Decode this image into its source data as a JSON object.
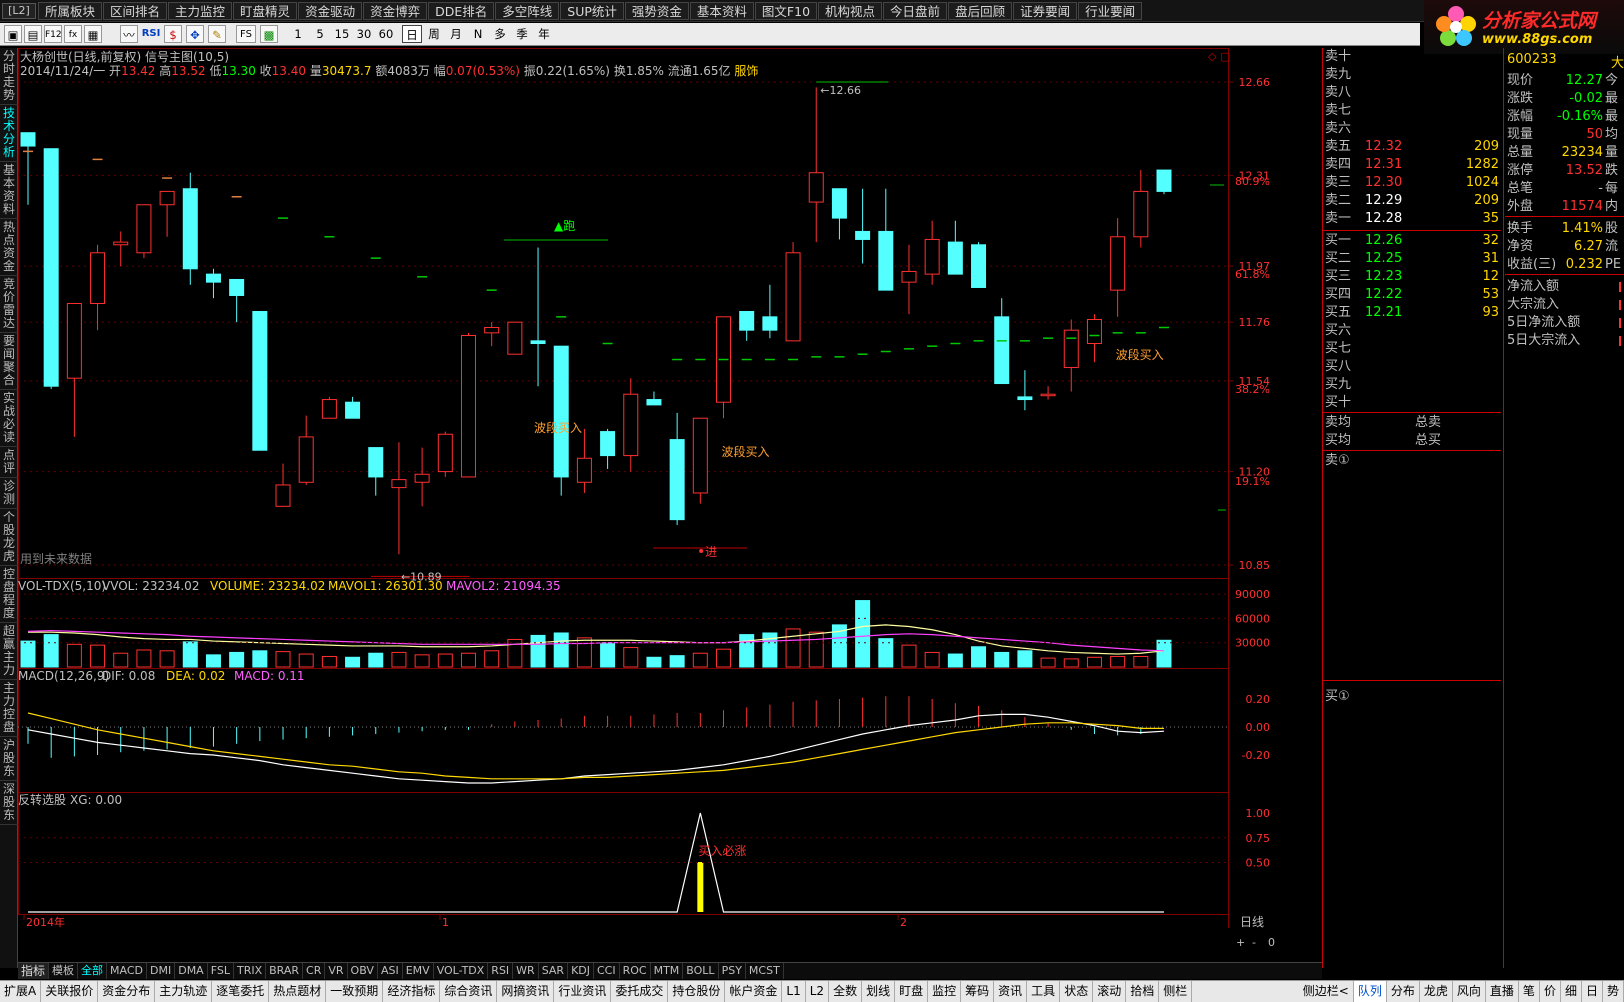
{
  "menu": {
    "tag": "[L2]",
    "items": [
      "所属板块",
      "区间排名",
      "主力监控",
      "盯盘精灵",
      "资金驱动",
      "资金博弈",
      "DDE排名",
      "多空阵线",
      "SUP统计",
      "强势资金",
      "基本资料",
      "图文F10",
      "机构视点",
      "今日盘前",
      "盘后回顾",
      "证券要闻",
      "行业要闻"
    ]
  },
  "logo": {
    "title": "分析家公式网",
    "url_text": "www.88gs.com"
  },
  "toolbar": {
    "rsi_label": "RSI",
    "fs_label": "FS",
    "minute_periods": [
      "1",
      "5",
      "15",
      "30",
      "60"
    ],
    "periods": [
      "日",
      "周",
      "月",
      "N",
      "多",
      "季",
      "年"
    ],
    "active_period": "日"
  },
  "left_tabs": [
    "分时走势",
    "技术分析",
    "基本资料",
    "热点资金",
    "竞价雷达",
    "要闻聚合",
    "实战必读",
    "点评",
    "诊测",
    "个股龙虎",
    "控盘程度",
    "超赢主力",
    "主力控盘",
    "沪股东",
    "深股东"
  ],
  "stock": {
    "title": "大杨创世(日线,前复权) 信号主图(10,5)",
    "date": "2014/11/24/一",
    "open_label": "开",
    "open": "13.42",
    "high_label": "高",
    "high": "13.52",
    "low_label": "低",
    "low": "13.30",
    "close_label": "收",
    "close": "13.40",
    "vol_label": "量",
    "vol": "30473.7",
    "amt_label": "额",
    "amt": "4083万",
    "chg_label": "幅",
    "chg": "0.07(0.53%)",
    "amp_label": "振",
    "amp": "0.22(1.65%)",
    "turnover_label": "换",
    "turnover": "1.85%",
    "float_label": "流通",
    "float": "1.65亿",
    "industry": "服饰"
  },
  "chart_data": [
    {
      "type": "candlestick",
      "title": "大杨创世(日线,前复权) 信号主图(10,5)",
      "y_ticks": [
        "12.66",
        "12.31",
        "11.97",
        "11.76",
        "11.54",
        "11.20",
        "10.85"
      ],
      "pct_ticks": [
        "80.9%",
        "61.8%",
        "38.2%",
        "19.1%"
      ],
      "x_labels": [
        "2014年",
        "1",
        "2"
      ],
      "candles": [
        {
          "o": 12.47,
          "h": 12.47,
          "l": 12.2,
          "c": 12.42
        },
        {
          "o": 12.41,
          "h": 12.41,
          "l": 11.51,
          "c": 11.52
        },
        {
          "o": 11.55,
          "h": 11.83,
          "l": 11.33,
          "c": 11.83
        },
        {
          "o": 11.83,
          "h": 12.05,
          "l": 11.73,
          "c": 12.02
        },
        {
          "o": 12.05,
          "h": 12.1,
          "l": 11.97,
          "c": 12.06
        },
        {
          "o": 12.02,
          "h": 12.2,
          "l": 12.0,
          "c": 12.2
        },
        {
          "o": 12.2,
          "h": 12.25,
          "l": 12.08,
          "c": 12.25
        },
        {
          "o": 12.26,
          "h": 12.32,
          "l": 11.9,
          "c": 11.96
        },
        {
          "o": 11.94,
          "h": 11.96,
          "l": 11.85,
          "c": 11.91
        },
        {
          "o": 11.92,
          "h": 11.92,
          "l": 11.76,
          "c": 11.86
        },
        {
          "o": 11.8,
          "h": 11.8,
          "l": 11.28,
          "c": 11.28
        },
        {
          "o": 11.07,
          "h": 11.23,
          "l": 11.07,
          "c": 11.15
        },
        {
          "o": 11.16,
          "h": 11.41,
          "l": 11.15,
          "c": 11.33
        },
        {
          "o": 11.4,
          "h": 11.48,
          "l": 11.4,
          "c": 11.47
        },
        {
          "o": 11.46,
          "h": 11.48,
          "l": 11.42,
          "c": 11.4
        },
        {
          "o": 11.29,
          "h": 11.29,
          "l": 11.11,
          "c": 11.18
        },
        {
          "o": 11.14,
          "h": 11.31,
          "l": 10.89,
          "c": 11.17
        },
        {
          "o": 11.16,
          "h": 11.29,
          "l": 11.07,
          "c": 11.19
        },
        {
          "o": 11.2,
          "h": 11.35,
          "l": 11.18,
          "c": 11.34
        },
        {
          "o": 11.18,
          "h": 11.72,
          "l": 11.18,
          "c": 11.71
        },
        {
          "o": 11.72,
          "h": 11.76,
          "l": 11.67,
          "c": 11.74
        },
        {
          "o": 11.64,
          "h": 11.71,
          "l": 11.7,
          "c": 11.76
        },
        {
          "o": 11.69,
          "h": 12.04,
          "l": 11.52,
          "c": 11.68
        },
        {
          "o": 11.67,
          "h": 11.67,
          "l": 11.11,
          "c": 11.18
        },
        {
          "o": 11.16,
          "h": 11.36,
          "l": 11.12,
          "c": 11.25
        },
        {
          "o": 11.35,
          "h": 11.36,
          "l": 11.21,
          "c": 11.26
        },
        {
          "o": 11.26,
          "h": 11.55,
          "l": 11.2,
          "c": 11.49
        },
        {
          "o": 11.47,
          "h": 11.5,
          "l": 11.47,
          "c": 11.45
        },
        {
          "o": 11.32,
          "h": 11.42,
          "l": 11.0,
          "c": 11.02
        },
        {
          "o": 11.12,
          "h": 11.4,
          "l": 11.08,
          "c": 11.4
        },
        {
          "o": 11.46,
          "h": 11.78,
          "l": 11.4,
          "c": 11.78
        },
        {
          "o": 11.8,
          "h": 11.8,
          "l": 11.69,
          "c": 11.73
        },
        {
          "o": 11.78,
          "h": 11.9,
          "l": 11.7,
          "c": 11.73
        },
        {
          "o": 11.69,
          "h": 12.06,
          "l": 11.69,
          "c": 12.02
        },
        {
          "o": 12.21,
          "h": 12.64,
          "l": 12.06,
          "c": 12.32
        },
        {
          "o": 12.26,
          "h": 12.25,
          "l": 12.07,
          "c": 12.15
        },
        {
          "o": 12.1,
          "h": 12.26,
          "l": 11.98,
          "c": 12.07
        },
        {
          "o": 12.1,
          "h": 12.26,
          "l": 11.88,
          "c": 11.88
        },
        {
          "o": 11.91,
          "h": 12.05,
          "l": 11.79,
          "c": 11.95
        },
        {
          "o": 11.94,
          "h": 12.14,
          "l": 11.9,
          "c": 12.07
        },
        {
          "o": 12.06,
          "h": 12.14,
          "l": 11.98,
          "c": 11.94
        },
        {
          "o": 12.05,
          "h": 12.06,
          "l": 11.9,
          "c": 11.89
        },
        {
          "o": 11.78,
          "h": 11.85,
          "l": 11.54,
          "c": 11.53
        },
        {
          "o": 11.48,
          "h": 11.58,
          "l": 11.43,
          "c": 11.47
        },
        {
          "o": 11.49,
          "h": 11.52,
          "l": 11.47,
          "c": 11.49
        },
        {
          "o": 11.59,
          "h": 11.77,
          "l": 11.5,
          "c": 11.73
        },
        {
          "o": 11.68,
          "h": 11.79,
          "l": 11.61,
          "c": 11.77
        },
        {
          "o": 11.88,
          "h": 12.15,
          "l": 11.78,
          "c": 12.08
        },
        {
          "o": 12.08,
          "h": 12.33,
          "l": 12.04,
          "c": 12.25
        },
        {
          "o": 12.33,
          "h": 12.33,
          "l": 12.24,
          "c": 12.25
        }
      ],
      "signal_line": [
        12.4,
        null,
        null,
        12.37,
        null,
        null,
        12.3,
        null,
        null,
        12.23,
        null,
        12.15,
        null,
        12.08,
        null,
        12.0,
        null,
        11.93,
        null,
        null,
        11.88,
        null,
        null,
        11.78,
        null,
        11.68,
        null,
        null,
        11.62,
        11.62,
        11.62,
        11.62,
        11.62,
        11.62,
        11.63,
        11.63,
        11.64,
        11.65,
        11.66,
        11.67,
        11.68,
        11.69,
        11.69,
        11.69,
        11.7,
        11.7,
        11.71,
        11.72,
        11.72,
        11.74
      ],
      "annotations": [
        {
          "text": "12.66",
          "type": "high"
        },
        {
          "text": "10.89",
          "type": "low"
        },
        {
          "text": "▲跑"
        },
        {
          "text": "进"
        },
        {
          "text": "波段买入"
        },
        {
          "text": "波段买入"
        },
        {
          "text": "波段买入"
        }
      ],
      "note": "用到未来数据"
    },
    {
      "type": "bar",
      "title": "VOL-TDX(5,10)",
      "series_labels": [
        "VVOL: 23234.02",
        "VOLUME: 23234.02",
        "MAVOL1: 26301.30",
        "MAVOL2: 21094.35"
      ],
      "y_ticks": [
        "90000",
        "60000",
        "30000"
      ],
      "values": [
        32000,
        40000,
        28000,
        27000,
        17000,
        21000,
        20000,
        31000,
        15000,
        18000,
        20000,
        19000,
        16000,
        13000,
        12000,
        17000,
        18000,
        15000,
        16000,
        17000,
        20000,
        34000,
        39000,
        42000,
        36000,
        30000,
        24000,
        12000,
        14000,
        17000,
        22000,
        40000,
        42000,
        47000,
        43000,
        52000,
        82000,
        35000,
        27000,
        18000,
        16000,
        25000,
        18000,
        20000,
        11000,
        10000,
        12000,
        13000,
        13000,
        33000,
        49000,
        23000
      ],
      "mavol1": [
        43000,
        43000,
        42000,
        40000,
        37000,
        35000,
        34000,
        34000,
        32000,
        31000,
        30000,
        29000,
        28000,
        27000,
        26000,
        26000,
        26000,
        25000,
        25000,
        25000,
        26000,
        28000,
        30000,
        32000,
        33000,
        33000,
        33000,
        32000,
        31000,
        30000,
        30000,
        32000,
        35000,
        38000,
        41000,
        44000,
        50000,
        52000,
        50000,
        46000,
        40000,
        32000,
        26000,
        23000,
        20000,
        18000,
        17000,
        16000,
        17000,
        20000,
        25000,
        26301
      ],
      "mavol2": [
        44000,
        45000,
        44000,
        43000,
        42000,
        41000,
        40000,
        38000,
        37000,
        36000,
        35000,
        34000,
        33000,
        32000,
        31000,
        30000,
        29000,
        28000,
        28000,
        28000,
        28000,
        28000,
        28000,
        29000,
        29000,
        30000,
        30000,
        30000,
        30000,
        30000,
        30000,
        31000,
        32000,
        33000,
        34000,
        36000,
        38000,
        40000,
        41000,
        40000,
        38000,
        36000,
        34000,
        32000,
        30000,
        27000,
        25000,
        23000,
        21000,
        20000,
        20000,
        21094
      ]
    },
    {
      "type": "line",
      "title": "MACD(12,26,9)",
      "series_labels": [
        "DIF: 0.08",
        "DEA: 0.02",
        "MACD: 0.11"
      ],
      "y_ticks": [
        "0.20",
        "0.00",
        "-0.20"
      ],
      "dif": [
        -0.02,
        -0.05,
        -0.08,
        -0.11,
        -0.13,
        -0.15,
        -0.17,
        -0.19,
        -0.2,
        -0.22,
        -0.24,
        -0.27,
        -0.29,
        -0.31,
        -0.33,
        -0.35,
        -0.37,
        -0.38,
        -0.39,
        -0.4,
        -0.4,
        -0.39,
        -0.38,
        -0.37,
        -0.35,
        -0.34,
        -0.33,
        -0.32,
        -0.31,
        -0.29,
        -0.27,
        -0.24,
        -0.21,
        -0.17,
        -0.13,
        -0.09,
        -0.05,
        -0.02,
        0.01,
        0.03,
        0.05,
        0.08,
        0.09,
        0.09,
        0.07,
        0.04,
        0.01,
        -0.03,
        -0.04,
        -0.03,
        0.02,
        0.08
      ],
      "dea": [
        0.1,
        0.06,
        0.02,
        -0.02,
        -0.05,
        -0.08,
        -0.11,
        -0.14,
        -0.17,
        -0.19,
        -0.21,
        -0.23,
        -0.25,
        -0.27,
        -0.28,
        -0.3,
        -0.32,
        -0.33,
        -0.35,
        -0.36,
        -0.37,
        -0.37,
        -0.37,
        -0.37,
        -0.36,
        -0.36,
        -0.35,
        -0.34,
        -0.33,
        -0.32,
        -0.31,
        -0.29,
        -0.27,
        -0.25,
        -0.22,
        -0.19,
        -0.16,
        -0.13,
        -0.1,
        -0.07,
        -0.04,
        -0.02,
        0.0,
        0.02,
        0.03,
        0.03,
        0.02,
        0.01,
        -0.01,
        -0.01,
        0.0,
        0.02
      ],
      "macd": [
        -0.12,
        -0.22,
        -0.21,
        -0.2,
        -0.18,
        -0.17,
        -0.16,
        -0.15,
        -0.14,
        -0.12,
        -0.1,
        -0.09,
        -0.08,
        -0.07,
        -0.06,
        -0.05,
        -0.04,
        -0.03,
        -0.02,
        -0.02,
        0.02,
        0.04,
        0.05,
        0.06,
        0.08,
        0.08,
        0.08,
        0.09,
        0.1,
        0.1,
        0.12,
        0.14,
        0.16,
        0.18,
        0.19,
        0.2,
        0.21,
        0.22,
        0.22,
        0.2,
        0.17,
        0.15,
        0.12,
        0.07,
        0.03,
        -0.02,
        -0.05,
        -0.06,
        -0.05,
        0.0,
        0.05,
        0.11
      ]
    },
    {
      "type": "line",
      "title": "反转选股",
      "series_labels": [
        "XG: 0.00"
      ],
      "y_ticks": [
        "1.00",
        "0.75",
        "0.50"
      ],
      "values": [
        0,
        0,
        0,
        0,
        0,
        0,
        0,
        0,
        0,
        0,
        0,
        0,
        0,
        0,
        0,
        0,
        0,
        0,
        0,
        0,
        0,
        0,
        0,
        0,
        0,
        0,
        0,
        0,
        0,
        1,
        0,
        0,
        0,
        0,
        0,
        0,
        0,
        0,
        0,
        0,
        0,
        0,
        0,
        0,
        0,
        0,
        0,
        0,
        0,
        0,
        0,
        0
      ],
      "annotations": [
        {
          "text": "买入必涨"
        }
      ]
    }
  ],
  "right_axis_label": "日线",
  "right_axis_ctrl": [
    "+",
    "-",
    "0"
  ],
  "orderbook": {
    "code": "600233",
    "code_suffix": "大",
    "sells": [
      {
        "label": "卖十",
        "price": "",
        "vol": ""
      },
      {
        "label": "卖九",
        "price": "",
        "vol": ""
      },
      {
        "label": "卖八",
        "price": "",
        "vol": ""
      },
      {
        "label": "卖七",
        "price": "",
        "vol": ""
      },
      {
        "label": "卖六",
        "price": "",
        "vol": ""
      },
      {
        "label": "卖五",
        "price": "12.32",
        "vol": "209"
      },
      {
        "label": "卖四",
        "price": "12.31",
        "vol": "1282"
      },
      {
        "label": "卖三",
        "price": "12.30",
        "vol": "1024"
      },
      {
        "label": "卖二",
        "price": "12.29",
        "vol": "209"
      },
      {
        "label": "卖一",
        "price": "12.28",
        "vol": "35"
      }
    ],
    "buys": [
      {
        "label": "买一",
        "price": "12.26",
        "vol": "32"
      },
      {
        "label": "买二",
        "price": "12.25",
        "vol": "31"
      },
      {
        "label": "买三",
        "price": "12.23",
        "vol": "12"
      },
      {
        "label": "买四",
        "price": "12.22",
        "vol": "53"
      },
      {
        "label": "买五",
        "price": "12.21",
        "vol": "93"
      },
      {
        "label": "买六",
        "price": "",
        "vol": ""
      },
      {
        "label": "买七",
        "price": "",
        "vol": ""
      },
      {
        "label": "买八",
        "price": "",
        "vol": ""
      },
      {
        "label": "买九",
        "price": "",
        "vol": ""
      },
      {
        "label": "买十",
        "price": "",
        "vol": ""
      }
    ],
    "sell_avg_label": "卖均",
    "total_sell_label": "总卖",
    "buy_avg_label": "买均",
    "total_buy_label": "总买",
    "sell_marker": "卖①",
    "buy_marker": "买①"
  },
  "quotes": [
    {
      "label": "现价",
      "value": "12.27",
      "color": "#00ff00",
      "suffix": "今"
    },
    {
      "label": "涨跌",
      "value": "-0.02",
      "color": "#00ff00",
      "suffix": "最"
    },
    {
      "label": "涨幅",
      "value": "-0.16%",
      "color": "#00ff00",
      "suffix": "最"
    },
    {
      "label": "现量",
      "value": "50",
      "color": "#ff3030",
      "suffix": "均"
    },
    {
      "label": "总量",
      "value": "23234",
      "color": "#ffd800",
      "suffix": "量"
    },
    {
      "label": "涨停",
      "value": "13.52",
      "color": "#ff3030",
      "suffix": "跌"
    },
    {
      "label": "总笔",
      "value": "-",
      "color": "#c0c0c0",
      "suffix": "每"
    },
    {
      "label": "外盘",
      "value": "11574",
      "color": "#ff3030",
      "suffix": "内"
    },
    {
      "label": "换手",
      "value": "1.41%",
      "color": "#ffd800",
      "suffix": "股"
    },
    {
      "label": "净资",
      "value": "6.27",
      "color": "#ffd800",
      "suffix": "流"
    },
    {
      "label": "收益(三)",
      "value": "0.232",
      "color": "#ffd800",
      "suffix": "PE"
    },
    {
      "label": "净流入额",
      "value": "",
      "color": "#ff3030",
      "suffix": ""
    },
    {
      "label": "大宗流入",
      "value": "",
      "color": "#ff3030",
      "suffix": ""
    },
    {
      "label": "5日净流入额",
      "value": "",
      "color": "#ff3030",
      "suffix": ""
    },
    {
      "label": "5日大宗流入",
      "value": "",
      "color": "#ff3030",
      "suffix": ""
    }
  ],
  "bottom_tabs1": [
    "指标",
    "模板",
    "全部",
    "MACD",
    "DMI",
    "DMA",
    "FSL",
    "TRIX",
    "BRAR",
    "CR",
    "VR",
    "OBV",
    "ASI",
    "EMV",
    "VOL-TDX",
    "RSI",
    "WR",
    "SAR",
    "KDJ",
    "CCI",
    "ROC",
    "MTM",
    "BOLL",
    "PSY",
    "MCST"
  ],
  "bottom_tabs1_active": "全部",
  "bottom_tabs2": [
    "扩展A",
    "关联报价",
    "资金分布",
    "主力轨迹",
    "逐笔委托",
    "热点题材",
    "一致预期",
    "经济指标",
    "综合资讯",
    "网摘资讯",
    "行业资讯",
    "委托成交",
    "持仓股份",
    "帐户资金",
    "L1",
    "L2",
    "全数",
    "划线",
    "盯盘",
    "监控",
    "筹码",
    "资讯",
    "工具",
    "状态",
    "滚动",
    "拾档",
    "侧栏"
  ],
  "bottom_tabs2_right": [
    "侧边栏<",
    "队列",
    "分布",
    "龙虎",
    "风向",
    "直播",
    "笔",
    "价",
    "细",
    "日",
    "势"
  ],
  "bottom_tabs2_active": "队列",
  "colors": {
    "up": "#ff3030",
    "down": "#54ffff",
    "signal": "#00c800",
    "annotation": "#ffa030",
    "grid": "#800000"
  }
}
